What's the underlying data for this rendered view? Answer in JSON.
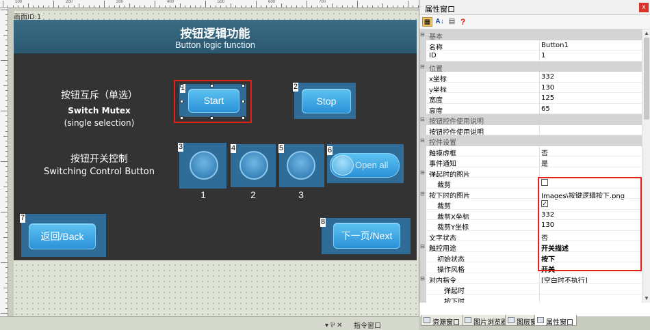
{
  "canvas": {
    "id_label": "画面ID:1"
  },
  "ruler": {
    "ticks": [
      "100",
      "200",
      "300",
      "400",
      "500",
      "600",
      "700"
    ]
  },
  "screen": {
    "title_cn": "按钮逻辑功能",
    "title_en": "Button logic function",
    "mutex": {
      "label_cn": "按钮互斥（单选）",
      "label_en": "Switch Mutex",
      "label_sub": "(single selection)"
    },
    "switching": {
      "label_cn": "按钮开关控制",
      "label_en": "Switching Control Button"
    },
    "buttons": {
      "start": {
        "tag": "1",
        "label": "Start"
      },
      "stop": {
        "tag": "2",
        "label": "Stop"
      },
      "sw1": {
        "tag": "3",
        "label": "1"
      },
      "sw2": {
        "tag": "4",
        "label": "2"
      },
      "sw3": {
        "tag": "5",
        "label": "3"
      },
      "open_all": {
        "tag": "6",
        "label": "Open all"
      },
      "back": {
        "tag": "7",
        "label": "返回/Back"
      },
      "next": {
        "tag": "8",
        "label": "下一页/Next"
      }
    }
  },
  "panel": {
    "title": "属性窗口",
    "close": "x",
    "rows": [
      {
        "type": "cat",
        "name": "基本"
      },
      {
        "type": "prop",
        "name": "名称",
        "value": "Button1"
      },
      {
        "type": "prop",
        "name": "ID",
        "value": "1"
      },
      {
        "type": "cat",
        "name": "位置"
      },
      {
        "type": "prop",
        "name": "x坐标",
        "value": "332"
      },
      {
        "type": "prop",
        "name": "y坐标",
        "value": "130"
      },
      {
        "type": "prop",
        "name": "宽度",
        "value": "125"
      },
      {
        "type": "prop",
        "name": "高度",
        "value": "65"
      },
      {
        "type": "cat",
        "name": "按钮控件使用说明"
      },
      {
        "type": "prop",
        "name": "按钮控件使用说明",
        "value": ""
      },
      {
        "type": "cat",
        "name": "控件设置"
      },
      {
        "type": "prop",
        "name": "触摸虚框",
        "value": "否"
      },
      {
        "type": "prop",
        "name": "事件通知",
        "value": "是"
      },
      {
        "type": "group",
        "name": "弹起时的图片",
        "value": ""
      },
      {
        "type": "sub",
        "name": "裁剪",
        "check": false
      },
      {
        "type": "group",
        "name": "按下时的图片",
        "value": "Images\\按键逻辑按下.png"
      },
      {
        "type": "sub",
        "name": "裁剪",
        "check": true
      },
      {
        "type": "sub",
        "name": "裁剪X坐标",
        "value": "332"
      },
      {
        "type": "sub",
        "name": "裁剪Y坐标",
        "value": "130"
      },
      {
        "type": "prop",
        "name": "文字状态",
        "value": "否"
      },
      {
        "type": "group",
        "name": "触控用途",
        "value": "开关描述",
        "bold": true
      },
      {
        "type": "sub",
        "name": "初始状态",
        "value": "按下",
        "bold": true
      },
      {
        "type": "sub",
        "name": "操作风格",
        "value": "开关",
        "bold": true
      },
      {
        "type": "group",
        "name": "对内指令",
        "value": "[空白时不执行]"
      },
      {
        "type": "sub2",
        "name": "弹起时",
        "value": ""
      },
      {
        "type": "sub2",
        "name": "按下时",
        "value": ""
      }
    ],
    "tabs": [
      "资源窗口",
      "图片浏览器",
      "图层窗口",
      "属性窗口"
    ]
  },
  "bottom": {
    "dock_controls": "▾ ⅌ ✕",
    "command_window": "指令窗口"
  },
  "colors": {
    "accent": "#2b91d7",
    "highlight": "#e5201b",
    "screen_bg": "#333333"
  }
}
